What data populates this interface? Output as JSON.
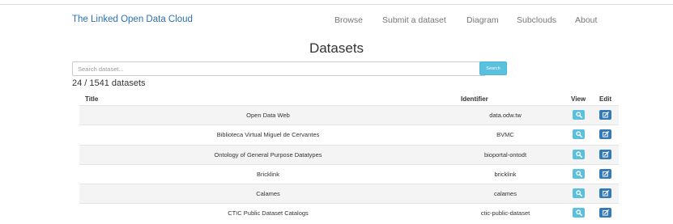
{
  "navbar": {
    "brand": "The Linked Open Data Cloud",
    "items": [
      "Browse",
      "Submit a dataset",
      "Diagram",
      "Subclouds",
      "About"
    ]
  },
  "page": {
    "title": "Datasets",
    "count_text": "24 / 1541 datasets"
  },
  "search": {
    "placeholder": "Search dataset...",
    "button_label": "Search"
  },
  "table": {
    "headers": {
      "title": "Title",
      "identifier": "Identifier",
      "view": "View",
      "edit": "Edit"
    },
    "rows": [
      {
        "title": "Open Data Web",
        "identifier": "data.odw.tw"
      },
      {
        "title": "Biblioteca Virtual Miguel de Cervantes",
        "identifier": "BVMC"
      },
      {
        "title": "Ontology of General Purpose Datatypes",
        "identifier": "bioportal-ontodt"
      },
      {
        "title": "Bricklink",
        "identifier": "bricklink"
      },
      {
        "title": "Calames",
        "identifier": "calames"
      },
      {
        "title": "CTIC Public Dataset Catalogs",
        "identifier": "ctic-public-dataset"
      }
    ]
  },
  "icons": {
    "view": "search-icon",
    "edit": "edit-icon"
  },
  "colors": {
    "brand": "#2a6fb6",
    "view_button": "#5bc0de",
    "edit_button": "#337ab7"
  }
}
